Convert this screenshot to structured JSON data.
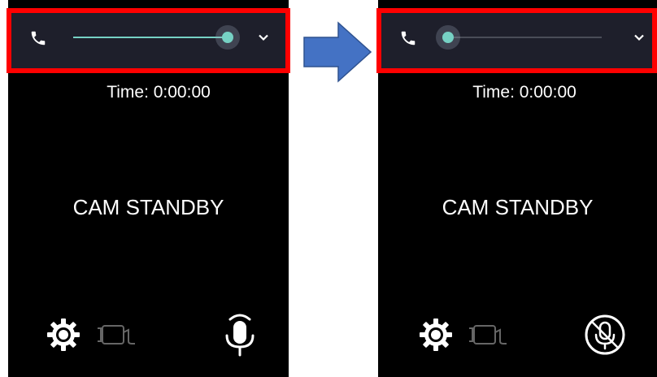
{
  "left_screen": {
    "time": "Time: 0:00:00",
    "status": "CAM STANDBY",
    "volume_level": 0.99
  },
  "right_screen": {
    "time": "Time: 0:00:00",
    "status": "CAM STANDBY",
    "volume_level": 0.03
  },
  "icons": [
    "phone-icon",
    "chevron-down-icon",
    "gear-icon",
    "camera-icon",
    "microphone-icon",
    "microphone-off-icon",
    "arrow-right-icon"
  ],
  "colors": {
    "highlight": "#ff0000",
    "slider_accent": "#76d1c4",
    "topbar_bg": "#1e1f2b",
    "arrow_fill": "#4472c4",
    "arrow_stroke": "#2f528f"
  }
}
